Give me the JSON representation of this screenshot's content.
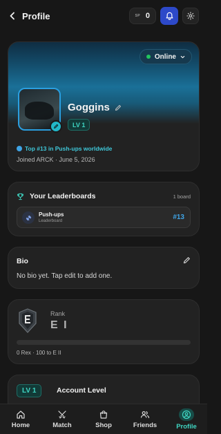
{
  "header": {
    "back_label": "Profile",
    "coin_tag": "SP",
    "coin_count": "0"
  },
  "profile": {
    "status": "Online",
    "username": "Goggins",
    "level_badge": "LV 1",
    "rank_line": "Top #13 in Push-ups worldwide",
    "joined": "Joined ARCK · June 5, 2026"
  },
  "leaderboards": {
    "title": "Your Leaderboards",
    "count": "1 board",
    "items": [
      {
        "name": "Push-ups",
        "subtitle": "Leaderboard",
        "rank": "#13"
      }
    ]
  },
  "bio": {
    "title": "Bio",
    "text": "No bio yet. Tap edit to add one."
  },
  "rank": {
    "label": "Rank",
    "value": "E I",
    "progress": 0,
    "detail": "0 Rex · 100 to E II"
  },
  "account_level": {
    "badge": "LV 1",
    "title": "Account Level"
  },
  "nav": {
    "items": [
      {
        "label": "Home",
        "icon": "home-icon"
      },
      {
        "label": "Match",
        "icon": "swords-icon"
      },
      {
        "label": "Shop",
        "icon": "shopping-bag-icon"
      },
      {
        "label": "Friends",
        "icon": "users-icon"
      },
      {
        "label": "Profile",
        "icon": "user-circle-icon",
        "active": true
      }
    ]
  },
  "colors": {
    "accent_teal": "#3fd6c3",
    "accent_blue": "#3fa4e6",
    "bell_bg": "#2d49c9",
    "online": "#22c55e",
    "background": "#171717",
    "card": "#222222"
  }
}
